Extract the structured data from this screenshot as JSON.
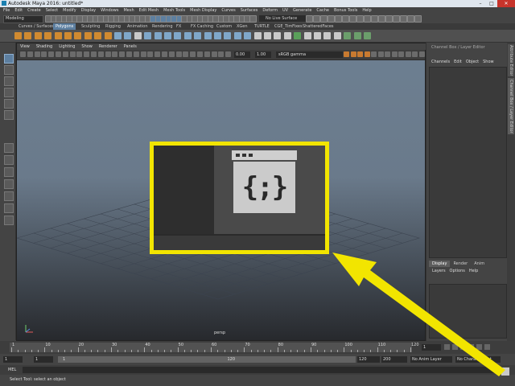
{
  "window": {
    "title": "Autodesk Maya 2016: untitled*",
    "controls": [
      "–",
      "□",
      "✕"
    ]
  },
  "menubar": [
    "File",
    "Edit",
    "Create",
    "Select",
    "Modify",
    "Display",
    "Windows",
    "Mesh",
    "Edit Mesh",
    "Mesh Tools",
    "Mesh Display",
    "Curves",
    "Surfaces",
    "Deform",
    "UV",
    "Generate",
    "Cache",
    "Bonus Tools",
    "Help"
  ],
  "statusline": {
    "menuset": "Modeling",
    "live_surface": "No Live Surface"
  },
  "shelf": {
    "tabs": [
      "Curves / Surfaces",
      "Polygons",
      "Sculpting",
      "Rigging",
      "Animation",
      "Rendering",
      "FX",
      "FX Caching",
      "Custom",
      "XGen",
      "TURTLE",
      "CGE_TimFixes",
      "ShatteredFaces"
    ],
    "active_tab": "Polygons"
  },
  "viewport": {
    "menu": [
      "View",
      "Shading",
      "Lighting",
      "Show",
      "Renderer",
      "Panels"
    ],
    "field_a": "0.00",
    "field_b": "1.00",
    "color_space": "sRGB gamma",
    "camera": "persp"
  },
  "channel_box": {
    "header": "Channel Box / Layer Editor",
    "menu": [
      "Channels",
      "Edit",
      "Object",
      "Show"
    ],
    "side_tabs": [
      "Attribute Editor",
      "Channel Box / Layer Editor"
    ],
    "layer_tabs": [
      "Display",
      "Render",
      "Anim"
    ],
    "active_layer_tab": "Display",
    "layer_menu": [
      "Layers",
      "Options",
      "Help"
    ]
  },
  "time_slider": {
    "ticks": [
      "1",
      "10",
      "20",
      "30",
      "40",
      "50",
      "60",
      "70",
      "80",
      "90",
      "100",
      "110",
      "120"
    ],
    "current_frame": "1"
  },
  "range_slider": {
    "start": "1",
    "start_inner": "1",
    "bar_start": "1",
    "bar_end": "120",
    "end_inner": "120",
    "end": "200",
    "anim_layer": "No Anim Layer",
    "char_set": "No Character Set"
  },
  "command_line": {
    "label": "MEL"
  },
  "help_line": {
    "text": "Select Tool: select an object"
  },
  "callout": {
    "icon_glyph": "{;}",
    "highlight_color": "#f2e500"
  }
}
